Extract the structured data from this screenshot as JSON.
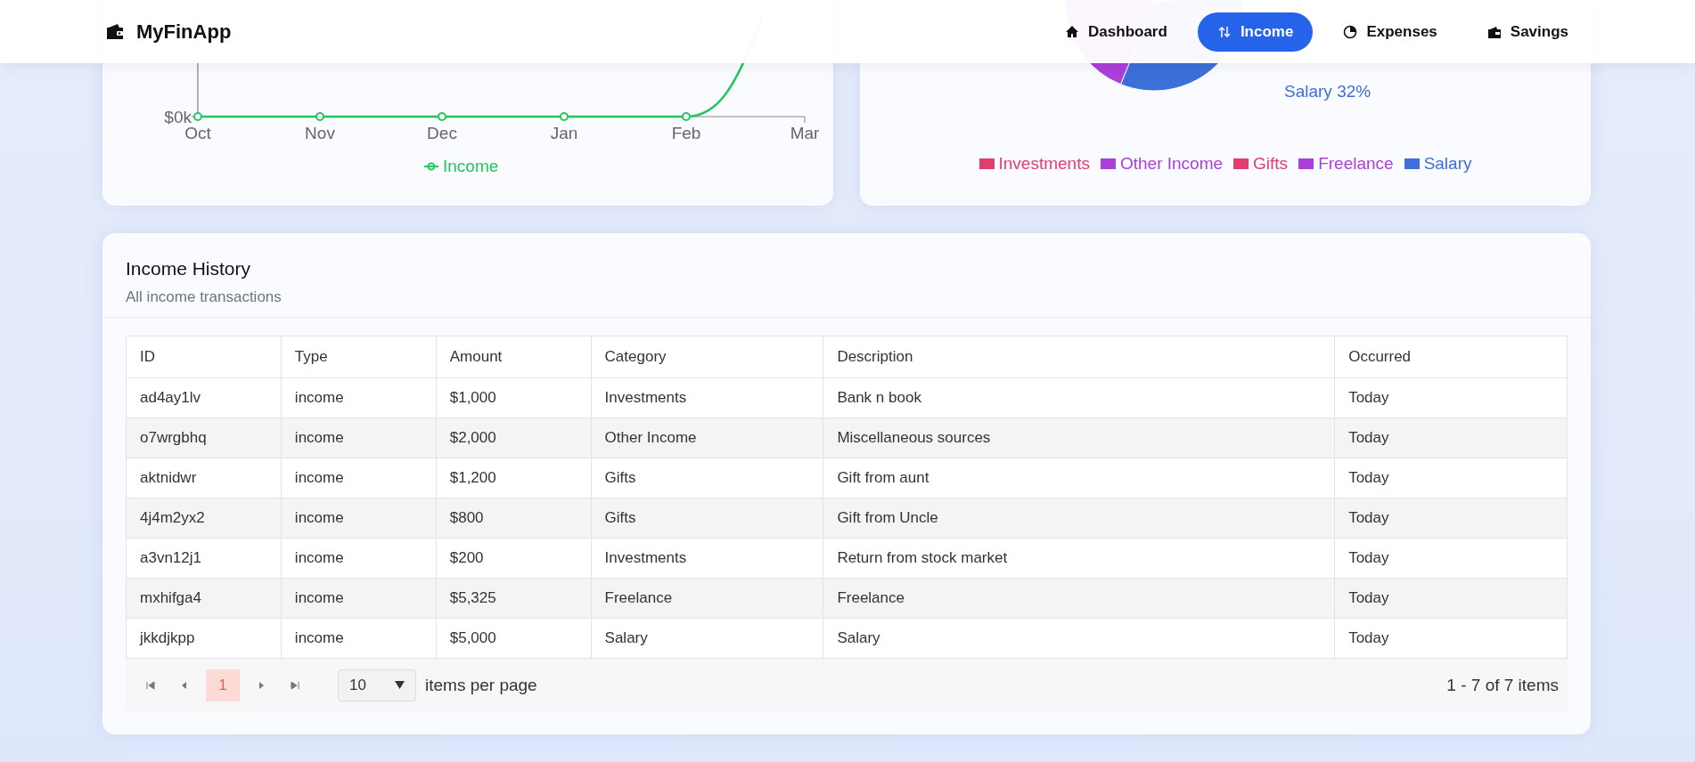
{
  "header": {
    "brand": "MyFinApp",
    "nav": [
      {
        "label": "Dashboard",
        "selected": false
      },
      {
        "label": "Income",
        "selected": true
      },
      {
        "label": "Expenses",
        "selected": false
      },
      {
        "label": "Savings",
        "selected": false
      }
    ]
  },
  "income_chart": {
    "y_tick_label": "$0k",
    "x_labels": [
      "Oct",
      "Nov",
      "Dec",
      "Jan",
      "Feb",
      "Mar"
    ],
    "legend": "Income"
  },
  "category_chart": {
    "slice_label": "Salary 32%",
    "legend": [
      {
        "label": "Investments",
        "color": "#e03e6f"
      },
      {
        "label": "Other Income",
        "color": "#aa3fdc"
      },
      {
        "label": "Gifts",
        "color": "#e03e6f"
      },
      {
        "label": "Freelance",
        "color": "#aa3fdc"
      },
      {
        "label": "Salary",
        "color": "#3c6fd8"
      }
    ]
  },
  "history": {
    "title": "Income History",
    "subtitle": "All income transactions",
    "columns": [
      "ID",
      "Type",
      "Amount",
      "Category",
      "Description",
      "Occurred"
    ],
    "rows": [
      [
        "ad4ay1lv",
        "income",
        "$1,000",
        "Investments",
        "Bank n book",
        "Today"
      ],
      [
        "o7wrgbhq",
        "income",
        "$2,000",
        "Other Income",
        "Miscellaneous sources",
        "Today"
      ],
      [
        "aktnidwr",
        "income",
        "$1,200",
        "Gifts",
        "Gift from aunt",
        "Today"
      ],
      [
        "4j4m2yx2",
        "income",
        "$800",
        "Gifts",
        "Gift from Uncle",
        "Today"
      ],
      [
        "a3vn12j1",
        "income",
        "$200",
        "Investments",
        "Return from stock market",
        "Today"
      ],
      [
        "mxhifga4",
        "income",
        "$5,325",
        "Freelance",
        "Freelance",
        "Today"
      ],
      [
        "jkkdjkpp",
        "income",
        "$5,000",
        "Salary",
        "Salary",
        "Today"
      ]
    ],
    "pager": {
      "pages": [
        {
          "label": "1",
          "selected": true
        }
      ],
      "page_size": "10",
      "page_size_label": "items per page",
      "summary": "1 - 7 of 7 items"
    }
  }
}
